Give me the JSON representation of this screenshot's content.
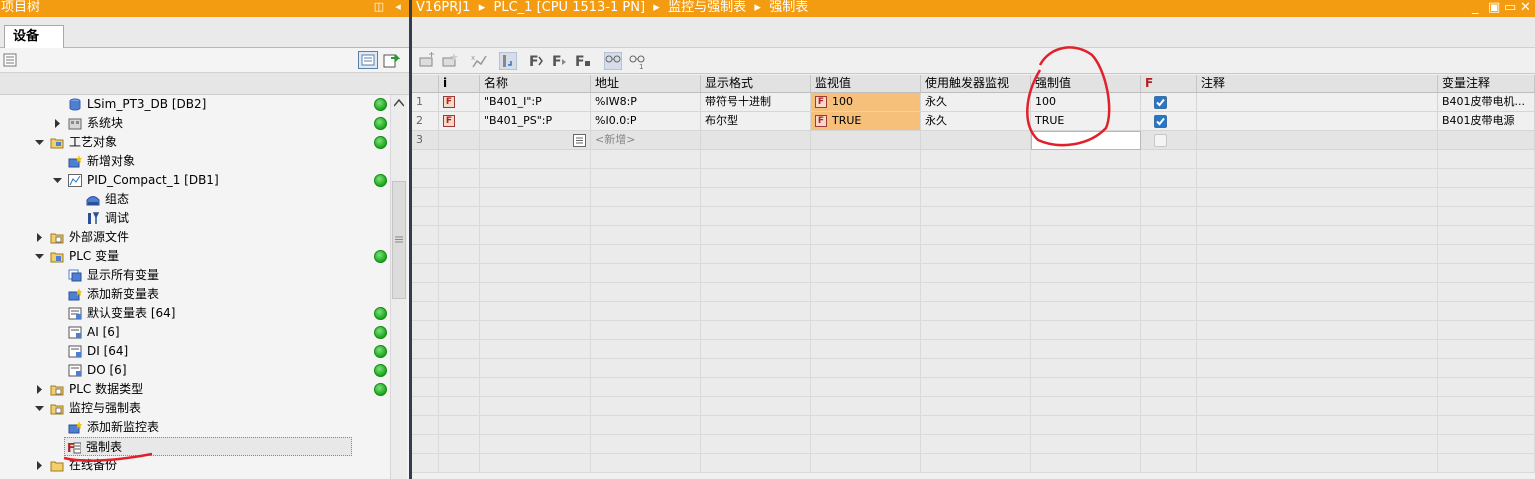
{
  "left_pane": {
    "title": "项目树",
    "tab_label": "设备",
    "tree": [
      {
        "label": "LSim_PT3_DB [DB2]",
        "status": "ok"
      },
      {
        "label": "系统块",
        "status": "ok"
      },
      {
        "label": "工艺对象",
        "status": "ok"
      },
      {
        "label": "新增对象",
        "status": ""
      },
      {
        "label": "PID_Compact_1 [DB1]",
        "status": "ok"
      },
      {
        "label": "组态",
        "status": ""
      },
      {
        "label": "调试",
        "status": ""
      },
      {
        "label": "外部源文件",
        "status": ""
      },
      {
        "label": "PLC 变量",
        "status": "ok"
      },
      {
        "label": "显示所有变量",
        "status": ""
      },
      {
        "label": "添加新变量表",
        "status": ""
      },
      {
        "label": "默认变量表 [64]",
        "status": "ok"
      },
      {
        "label": "AI [6]",
        "status": "ok"
      },
      {
        "label": "DI [64]",
        "status": "ok"
      },
      {
        "label": "DO [6]",
        "status": "ok"
      },
      {
        "label": "PLC 数据类型",
        "status": "ok"
      },
      {
        "label": "监控与强制表",
        "status": ""
      },
      {
        "label": "添加新监控表",
        "status": ""
      },
      {
        "label": "强制表",
        "status": ""
      },
      {
        "label": "在线备份",
        "status": ""
      }
    ]
  },
  "right_pane": {
    "breadcrumb": [
      "V16PRJ1",
      "PLC_1 [CPU 1513-1 PN]",
      "监控与强制表",
      "强制表"
    ],
    "columns": [
      "i",
      "名称",
      "地址",
      "显示格式",
      "监视值",
      "使用触发器监视",
      "强制值",
      "F",
      "注释",
      "变量注释"
    ],
    "rows": [
      {
        "num": "1",
        "name": "\"B401_I\":P",
        "address": "%IW8:P",
        "format": "带符号十进制",
        "monitor": "100",
        "trigger": "永久",
        "force": "100",
        "checked": true,
        "comment": "",
        "var_comment": "B401皮带电机..."
      },
      {
        "num": "2",
        "name": "\"B401_PS\":P",
        "address": "%I0.0:P",
        "format": "布尔型",
        "monitor": "TRUE",
        "trigger": "永久",
        "force": "TRUE",
        "checked": true,
        "comment": "",
        "var_comment": "B401皮带电源"
      }
    ],
    "new_row": {
      "num": "3",
      "placeholder": "<新增>"
    }
  },
  "colors": {
    "accent": "#f39c12",
    "monitor_bg": "#f7c07a",
    "status_ok": "#1aa81a",
    "annotation": "#e0202a"
  }
}
